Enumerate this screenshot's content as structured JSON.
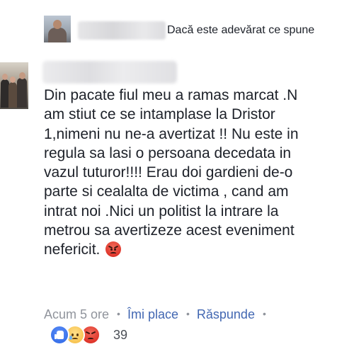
{
  "reply_preview": {
    "text": "Dacă este adevărat ce spune"
  },
  "comment": {
    "lines": [
      "Din pacate fiul meu a ramas marcat .N",
      "am stiut ce se intamplase la Dristor",
      "1,nimeni nu ne-a avertizat !! Nu este in",
      "regula sa lasi o persoana decedata in",
      "vazul tuturor!!!!  Erau doi gardieni de-o",
      "parte si cealalta de victima , cand am",
      "intrat noi .Nici un politist la intrare la",
      "metrou sa avertizeze acest eveniment",
      "nefericit."
    ],
    "trailing_emoji": "angry-face-icon"
  },
  "meta": {
    "time": "Acum 5 ore",
    "separator": "•",
    "like_label": "Îmi place",
    "reply_label": "Răspunde"
  },
  "reactions": {
    "icons": [
      "like-icon",
      "sad-icon",
      "angry-icon"
    ],
    "count": "39"
  },
  "colors": {
    "text": "#1d2129",
    "meta_gray": "#90949c",
    "link_blue": "#4267b2",
    "like_blue": "#2d67e6",
    "angry_red": "#e0372c",
    "sad_yellow": "#f5b93c"
  }
}
